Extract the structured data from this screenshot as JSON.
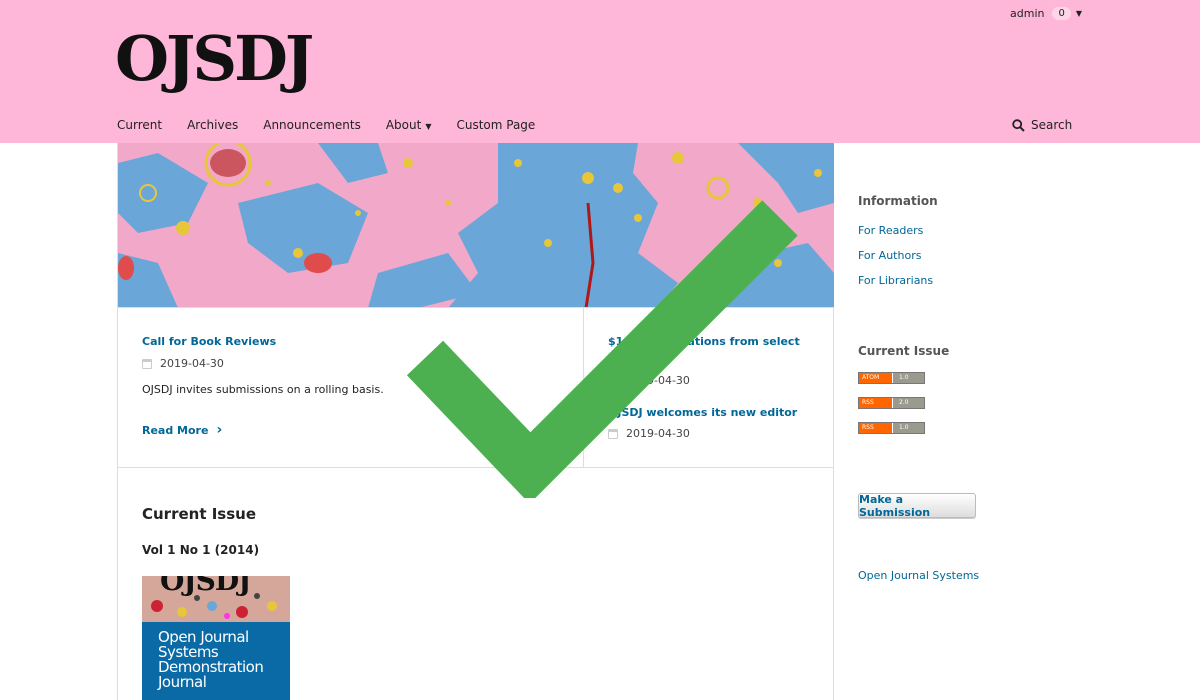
{
  "header": {
    "user_nav": {
      "username": "admin",
      "task_count": "0"
    },
    "site_name": "OJSDJ",
    "nav_items": [
      {
        "label": "Current"
      },
      {
        "label": "Archives"
      },
      {
        "label": "Announcements"
      },
      {
        "label": "About",
        "has_dropdown": true
      },
      {
        "label": "Custom Page"
      }
    ],
    "search_label": "Search"
  },
  "announcements": [
    {
      "title": "Call for Book Reviews",
      "date": "2019-04-30",
      "summary": "OJSDJ invites submissions on a rolling basis.",
      "read_more": "Read More"
    },
    {
      "title": "$10 ... translations from select",
      "date": "2019-04-30"
    },
    {
      "title": "OJSDJ welcomes its new editor",
      "date": "2019-04-30"
    }
  ],
  "current_issue": {
    "heading": "Current Issue",
    "identification": "Vol 1 No 1 (2014)",
    "cover_logo": "OJSDJ",
    "cover_title": "Open Journal Systems Demonstration Journal"
  },
  "sidebar": {
    "information_title": "Information",
    "information_links": [
      "For Readers",
      "For Authors",
      "For Librarians"
    ],
    "current_issue_title": "Current Issue",
    "feeds": [
      {
        "left": "ATOM",
        "right": "1.0"
      },
      {
        "left": "RSS",
        "right": "2.0"
      },
      {
        "left": "RSS",
        "right": "1.0"
      }
    ],
    "make_submission": "Make a Submission",
    "ojs_link": "Open Journal Systems"
  },
  "colors": {
    "header_bg": "#feb7d9",
    "link": "#006798",
    "checkmark": "#4caf50"
  }
}
